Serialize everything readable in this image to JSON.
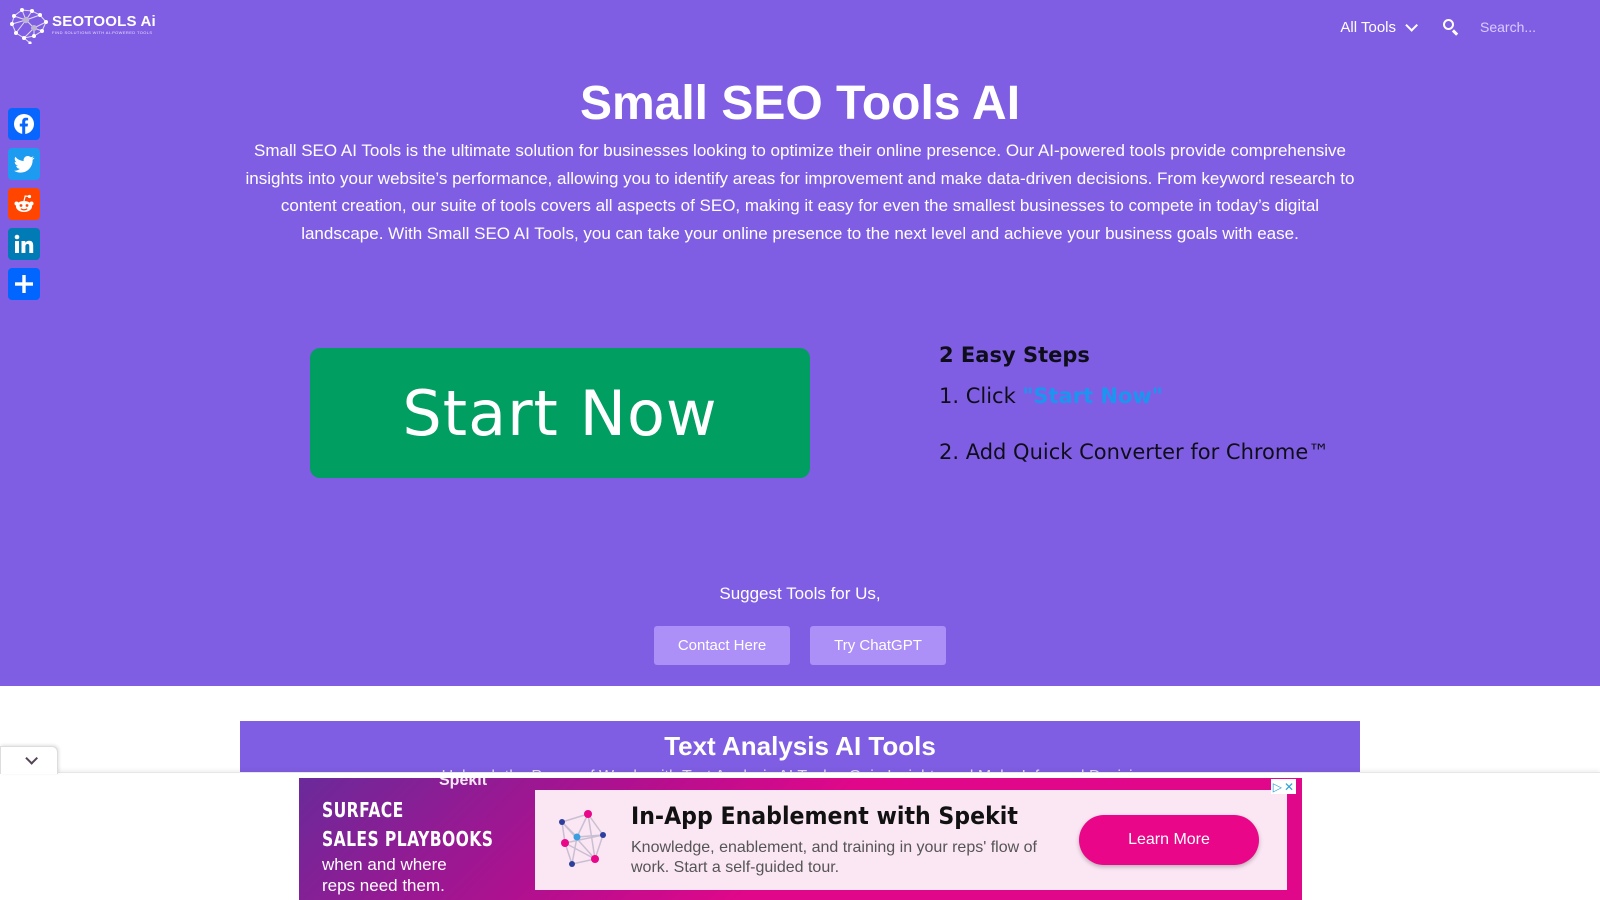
{
  "header": {
    "logo_title": "SEOTOOLS Ai",
    "logo_tagline": "FIND SOLUTIONS WITH AI-POWERED TOOLS",
    "nav_all_tools": "All Tools",
    "search_placeholder": "Search..."
  },
  "social": [
    "facebook",
    "twitter",
    "reddit",
    "linkedin",
    "share"
  ],
  "hero": {
    "title": "Small SEO Tools AI",
    "description": "Small SEO AI Tools is the ultimate solution for businesses looking to optimize their online presence. Our AI-powered tools provide comprehensive insights into your website’s performance, allowing you to identify areas for improvement and make data-driven decisions. From keyword research to content creation, our suite of tools covers all aspects of SEO, making it easy for even the smallest businesses to compete in today’s digital landscape. With Small SEO AI Tools, you can take your online presence to the next level and achieve your business goals with ease.",
    "start_button": "Start Now",
    "steps_title": "2 Easy Steps",
    "step1_prefix": "1. Click ",
    "step1_link": "\"Start Now\"",
    "step2": "2. Add Quick Converter for Chrome™",
    "suggest_text": "Suggest Tools for Us,",
    "contact_button": "Contact Here",
    "chatgpt_button": "Try ChatGPT"
  },
  "section": {
    "title": "Text Analysis AI Tools",
    "subtitle": "Unleash the Power of Words with Text Analysis AI Tools - Gain Insights and Make Informed Decisions"
  },
  "ad": {
    "brand": "Spekit",
    "left_line1": "SURFACE",
    "left_line2": "SALES PLAYBOOKS",
    "left_line3": "when and where",
    "left_line4": "reps need them.",
    "headline": "In-App Enablement with Spekit",
    "body": "Knowledge, enablement, and training in your reps' flow of work. Start a self-guided tour.",
    "cta": "Learn More",
    "adchoices": "▷",
    "close": "✕"
  },
  "colors": {
    "hero_bg": "#805ee3",
    "start_green": "#009e60",
    "link_blue": "#1b95f0",
    "ad_pink": "#e90688"
  }
}
